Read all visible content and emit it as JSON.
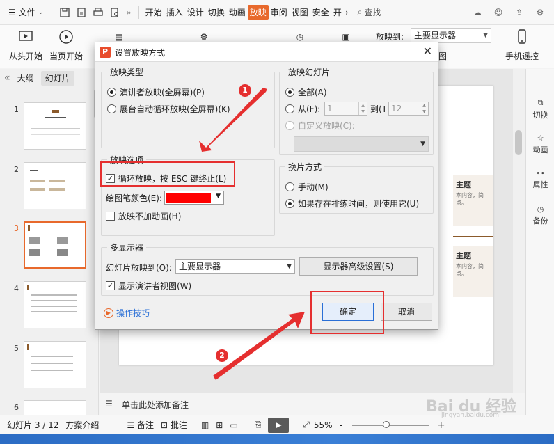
{
  "menubar": {
    "file_label": "文件",
    "tabs": [
      "开始",
      "插入",
      "设计",
      "切换",
      "动画",
      "放映",
      "审阅",
      "视图",
      "安全",
      "开"
    ],
    "active_tab": "放映",
    "search_label": "查找"
  },
  "ribbon": {
    "from_start": "从头开始",
    "from_current": "当页开始",
    "show_on_label": "放映到:",
    "show_on_value": "主要显示器",
    "remote_label": "手机遥控",
    "partial_label": "图"
  },
  "left_panel": {
    "collapse": "«",
    "tab_outline": "大纲",
    "tab_slides": "幻灯片",
    "slide_numbers": [
      "1",
      "2",
      "3",
      "4",
      "5",
      "6"
    ],
    "selected_slide": "3"
  },
  "slide_content": {
    "card1_title": "主题",
    "card1_sub1": "本内容，简",
    "card1_sub2": "点。",
    "card2_title": "主题",
    "card2_sub1": "本内容，简",
    "card2_sub2": "点。"
  },
  "right_panel": {
    "items": [
      "切换",
      "动画",
      "属性",
      "备份"
    ]
  },
  "notes": {
    "placeholder": "单击此处添加备注"
  },
  "status": {
    "slide_info": "幻灯片 3 / 12",
    "theme": "方案介绍",
    "notes_btn": "备注",
    "comments_btn": "批注",
    "zoom": "55%",
    "minus": "-",
    "plus": "+"
  },
  "dialog": {
    "title": "设置放映方式",
    "show_type": {
      "title": "放映类型",
      "presenter": "演讲者放映(全屏幕)(P)",
      "kiosk": "展台自动循环放映(全屏幕)(K)"
    },
    "show_slides": {
      "title": "放映幻灯片",
      "all": "全部(A)",
      "from": "从(F):",
      "from_value": "1",
      "to": "到(T):",
      "to_value": "12",
      "custom": "自定义放映(C):"
    },
    "show_options": {
      "title": "放映选项",
      "loop": "循环放映，按 ESC 键终止(L)",
      "pen_color": "绘图笔颜色(E):",
      "pen_color_value": "#ff0000",
      "no_animation": "放映不加动画(H)"
    },
    "advance": {
      "title": "换片方式",
      "manual": "手动(M)",
      "timings": "如果存在排练时间，则使用它(U)"
    },
    "multi_monitor": {
      "title": "多显示器",
      "show_on_label": "幻灯片放映到(O):",
      "show_on_value": "主要显示器",
      "advanced_btn": "显示器高级设置(S)",
      "presenter_view": "显示演讲者视图(W)"
    },
    "tips": "操作技巧",
    "ok": "确定",
    "cancel": "取消"
  },
  "annotations": {
    "badge1": "1",
    "badge2": "2",
    "color": "#e52f2f"
  },
  "watermark": {
    "text": "Bai du 经验",
    "sub": "jingyan.baidu.com"
  }
}
